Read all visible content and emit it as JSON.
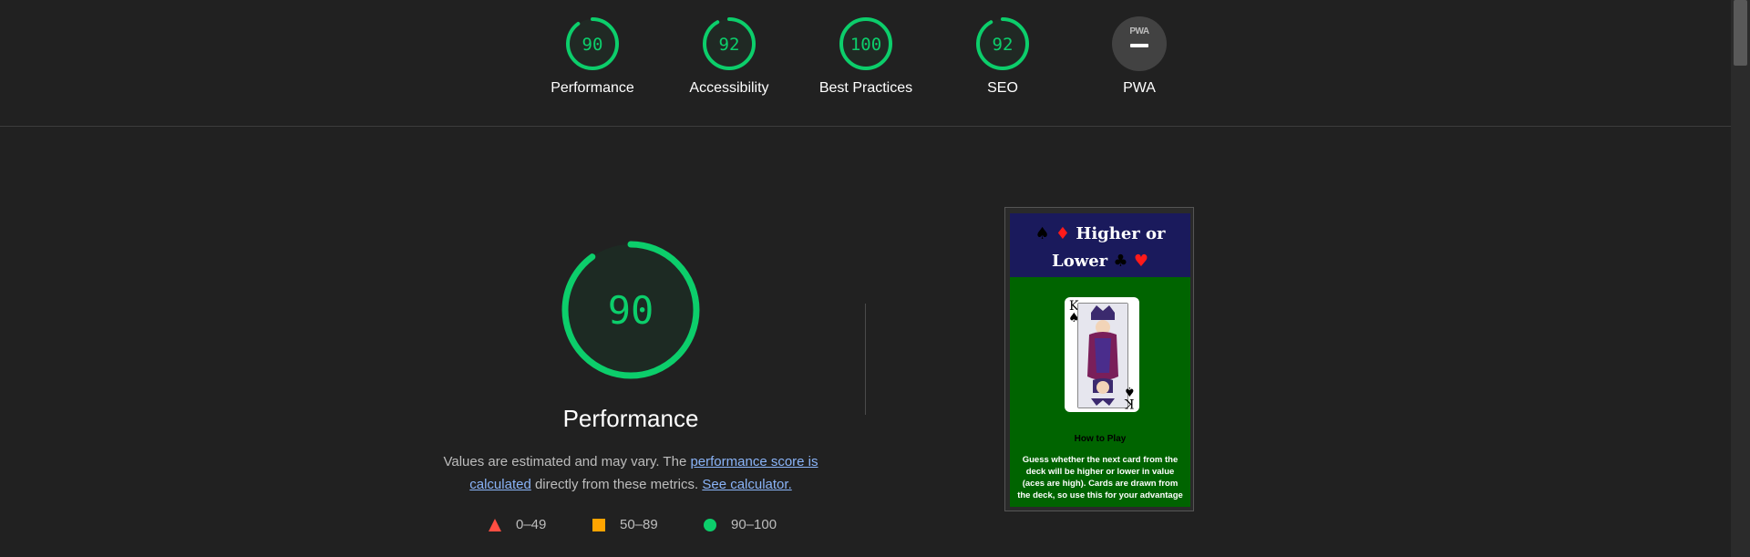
{
  "colors": {
    "pass": "#0cce6b",
    "average": "#ffa400",
    "fail": "#ff4e42",
    "link": "#8ab4f8",
    "background": "#212121"
  },
  "categories": [
    {
      "score": 90,
      "score_text": "90",
      "label": "Performance"
    },
    {
      "score": 92,
      "score_text": "92",
      "label": "Accessibility"
    },
    {
      "score": 100,
      "score_text": "100",
      "label": "Best Practices"
    },
    {
      "score": 92,
      "score_text": "92",
      "label": "SEO"
    }
  ],
  "pwa": {
    "badge_text": "PWA",
    "label": "PWA"
  },
  "main": {
    "score": 90,
    "score_text": "90",
    "title": "Performance",
    "desc_prefix": "Values are estimated and may vary. The ",
    "desc_link1": "performance score is calculated",
    "desc_middle": " directly from these metrics. ",
    "desc_link2": "See calculator."
  },
  "legend": [
    {
      "shape": "triangle",
      "label": "0–49"
    },
    {
      "shape": "square",
      "label": "50–89"
    },
    {
      "shape": "circle",
      "label": "90–100"
    }
  ],
  "thumbnail": {
    "title_line1": "Higher or",
    "title_line2": "Lower",
    "card_rank": "K",
    "card_suit": "♠",
    "how_to_play": "How to Play",
    "rules_text": "Guess whether the next card from the deck will be higher or lower in value (aces are high). Cards are drawn from the deck, so use this for your advantage"
  }
}
